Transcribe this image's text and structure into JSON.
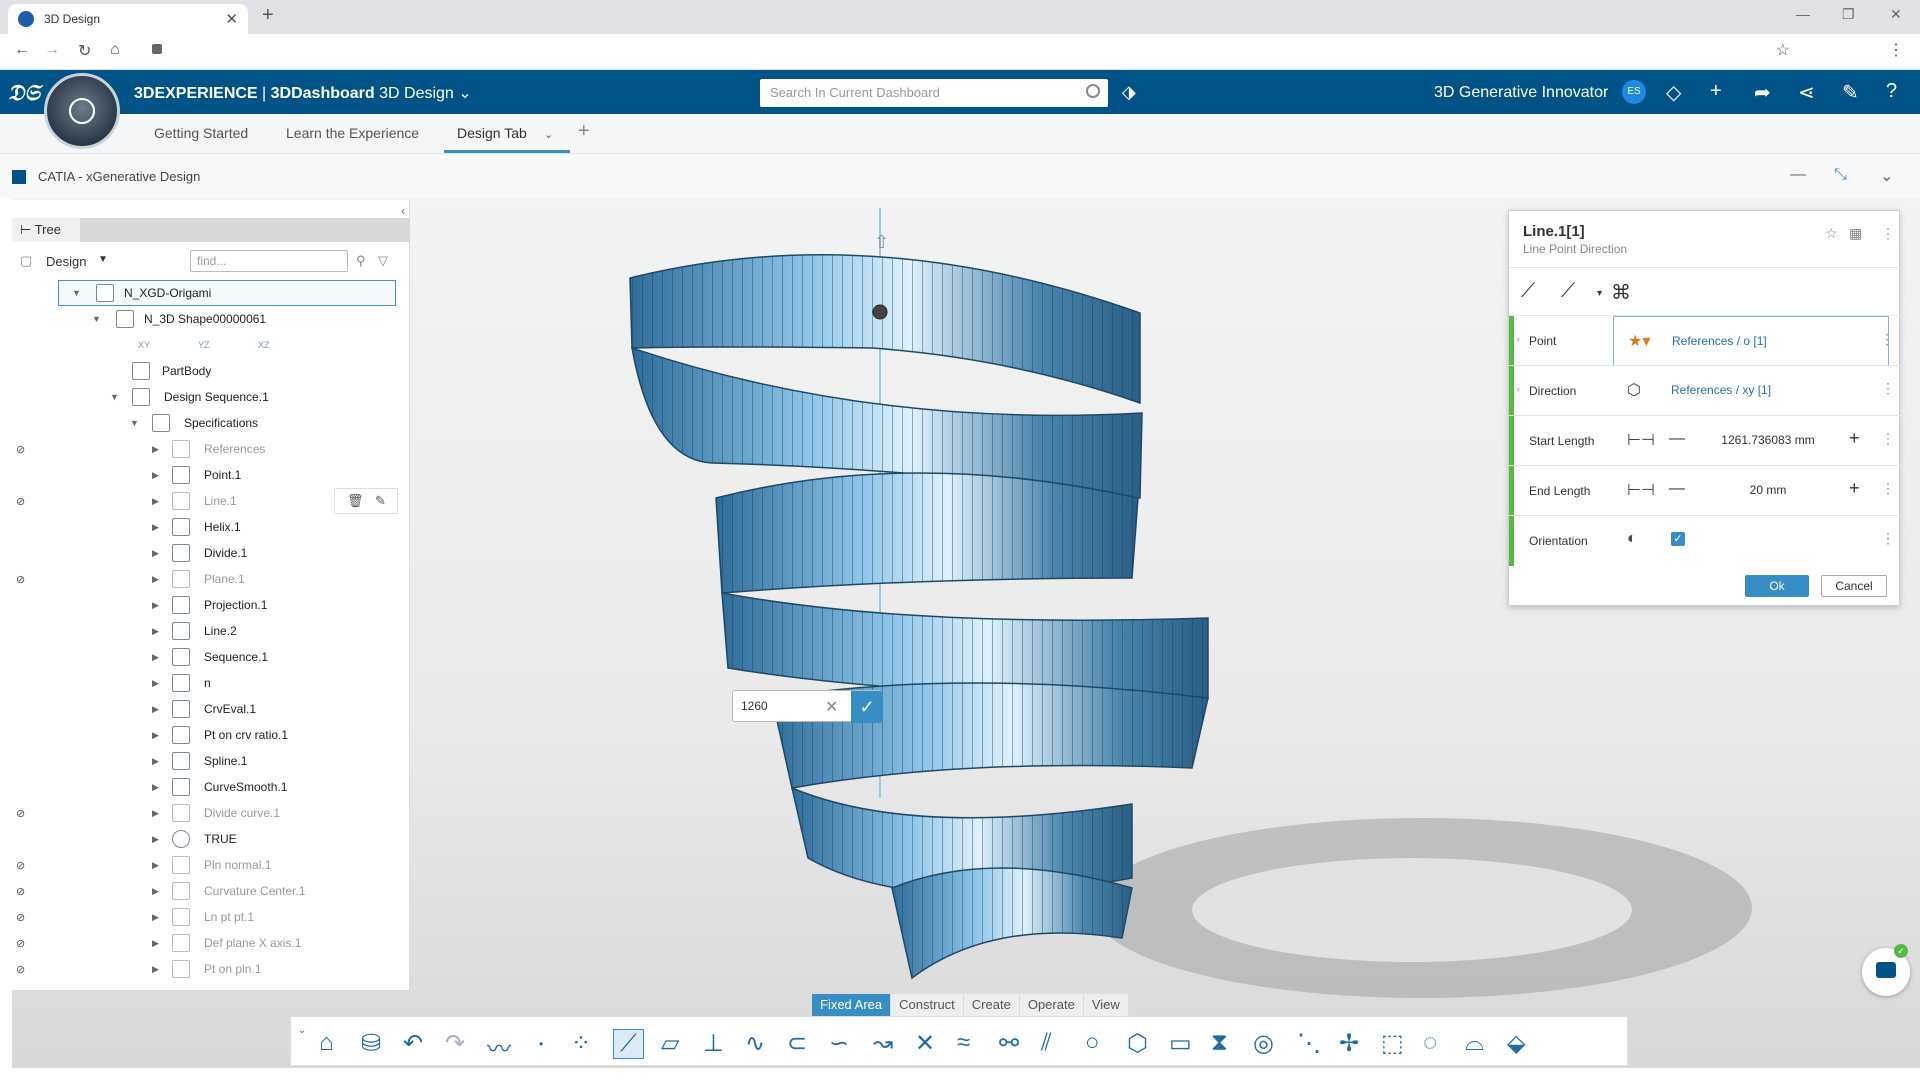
{
  "browser": {
    "tab_title": "3D Design",
    "tab_close": "✕",
    "new_tab": "+",
    "window_controls": [
      "—",
      "❐",
      "✕"
    ]
  },
  "topbar": {
    "brand": "3DEXPERIENCE",
    "separator": " | ",
    "dashboard": "3DDashboard",
    "app": "3D Design",
    "search_placeholder": "Search In Current Dashboard",
    "user_name": "3D Generative Innovator",
    "avatar_initials": "ES",
    "accent": "#005386"
  },
  "dashboard_tabs": {
    "items": [
      "Getting Started",
      "Learn the Experience",
      "Design Tab"
    ],
    "active": "Design Tab"
  },
  "app_header": {
    "title": "CATIA - xGenerative Design"
  },
  "tree": {
    "tab_label": "Tree",
    "design_label": "Design",
    "find_placeholder": "find...",
    "rows": [
      {
        "label": "N_XGD-Origami",
        "selected": true
      },
      {
        "label": "N_3D Shape00000061"
      },
      {
        "label": "PartBody"
      },
      {
        "label": "Design Sequence.1"
      },
      {
        "label": "Specifications"
      },
      {
        "label": "References",
        "hidden": true
      },
      {
        "label": "Point.1"
      },
      {
        "label": "Line.1",
        "hidden": true
      },
      {
        "label": "Helix.1"
      },
      {
        "label": "Divide.1"
      },
      {
        "label": "Plane.1",
        "hidden": true
      },
      {
        "label": "Projection.1"
      },
      {
        "label": "Line.2"
      },
      {
        "label": "Sequence.1"
      },
      {
        "label": "n"
      },
      {
        "label": "CrvEval.1"
      },
      {
        "label": "Pt on crv ratio.1"
      },
      {
        "label": "Spline.1"
      },
      {
        "label": "CurveSmooth.1"
      },
      {
        "label": "Divide curve.1",
        "hidden": true
      },
      {
        "label": "TRUE"
      },
      {
        "label": "Pln normal.1",
        "hidden": true
      },
      {
        "label": "Curvature Center.1",
        "hidden": true
      },
      {
        "label": "Ln pt pt.1",
        "hidden": true
      },
      {
        "label": "Def plane X axis.1",
        "hidden": true
      },
      {
        "label": "Pt on pln.1",
        "hidden": true
      }
    ],
    "plane_labels": [
      "XY",
      "YZ",
      "XZ"
    ]
  },
  "inline_edit": {
    "value": "1260"
  },
  "panel": {
    "title": "Line.1[1]",
    "subtitle": "Line Point Direction",
    "point_label": "Point",
    "point_value": "References / o [1]",
    "direction_label": "Direction",
    "direction_value": "References / xy [1]",
    "start_length_label": "Start Length",
    "start_length_value": "1261.736083 mm",
    "end_length_label": "End Length",
    "end_length_value": "20 mm",
    "orientation_label": "Orientation",
    "orientation_checked": true,
    "ok_label": "Ok",
    "cancel_label": "Cancel",
    "bar_color": "#57b847"
  },
  "action_bar": {
    "tabs": [
      "Fixed Area",
      "Construct",
      "Create",
      "Operate",
      "View"
    ],
    "active": "Fixed Area"
  }
}
